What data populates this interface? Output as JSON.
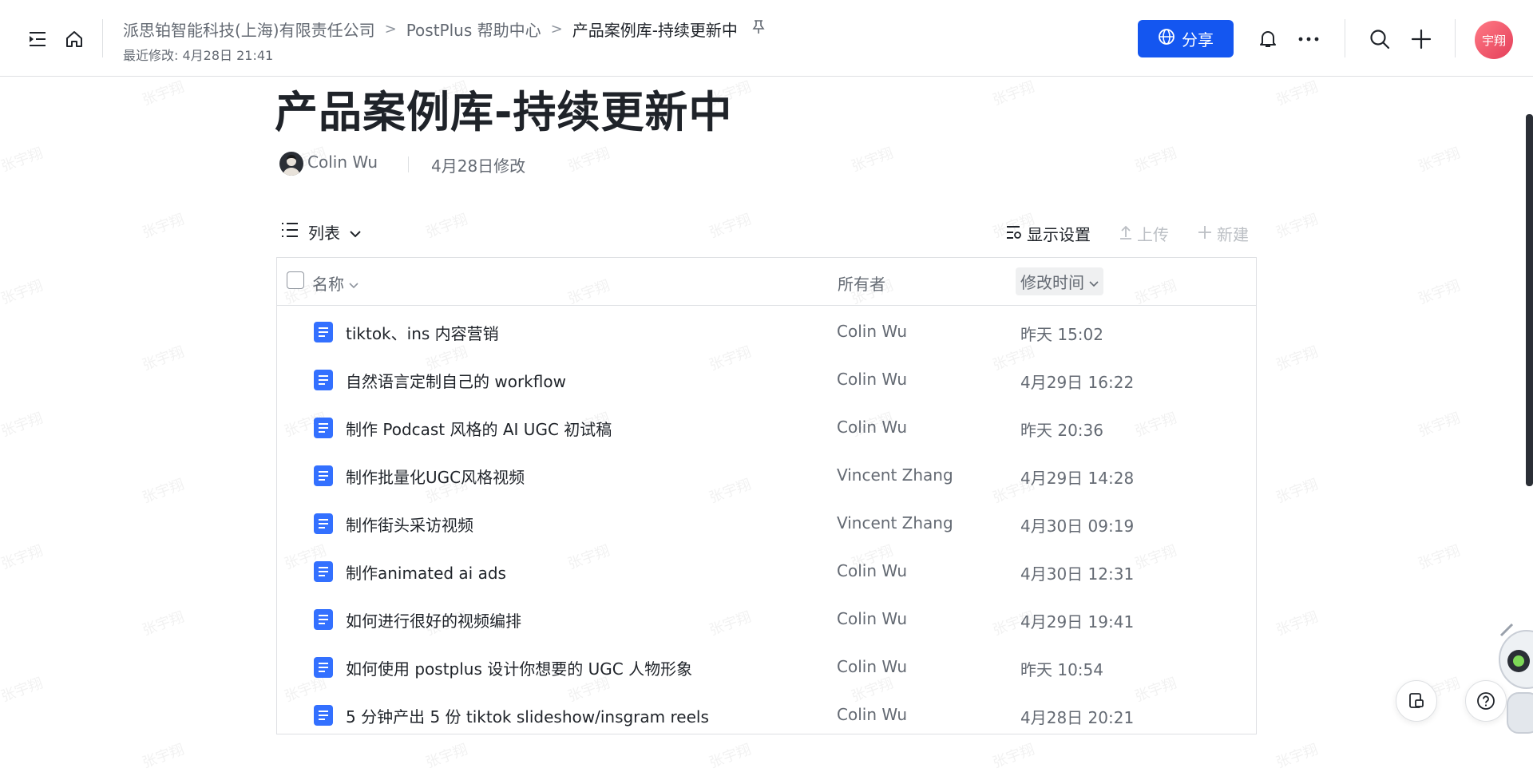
{
  "header": {
    "breadcrumbs": [
      "派思铂智能科技(上海)有限责任公司",
      "PostPlus 帮助中心",
      "产品案例库-持续更新中"
    ],
    "last_modified": "最近修改: 4月28日 21:41",
    "share_label": "分享",
    "user_avatar_text": "宇翔"
  },
  "doc": {
    "title": "产品案例库-持续更新中",
    "author": "Colin Wu",
    "edited": "4月28日修改"
  },
  "toolbar": {
    "view_label": "列表",
    "display_settings": "显示设置",
    "upload": "上传",
    "new": "新建"
  },
  "table": {
    "columns": {
      "name": "名称",
      "owner": "所有者",
      "modified": "修改时间"
    },
    "rows": [
      {
        "name": "tiktok、ins 内容营销",
        "owner": "Colin Wu",
        "modified": "昨天 15:02"
      },
      {
        "name": "自然语言定制自己的 workflow",
        "owner": "Colin Wu",
        "modified": "4月29日 16:22"
      },
      {
        "name": "制作 Podcast 风格的 AI UGC 初试稿",
        "owner": "Colin Wu",
        "modified": "昨天 20:36"
      },
      {
        "name": "制作批量化UGC风格视频",
        "owner": "Vincent Zhang",
        "modified": "4月29日 14:28"
      },
      {
        "name": "制作街头采访视频",
        "owner": "Vincent Zhang",
        "modified": "4月30日 09:19"
      },
      {
        "name": "制作animated ai ads",
        "owner": "Colin Wu",
        "modified": "4月30日 12:31"
      },
      {
        "name": "如何进行很好的视频编排",
        "owner": "Colin Wu",
        "modified": "4月29日 19:41"
      },
      {
        "name": "如何使用 postplus 设计你想要的 UGC 人物形象",
        "owner": "Colin Wu",
        "modified": "昨天 10:54"
      },
      {
        "name": "5 分钟产出 5 份 tiktok slideshow/insgram reels",
        "owner": "Colin Wu",
        "modified": "4月28日 20:21"
      }
    ]
  },
  "watermark": "张宇翔",
  "colors": {
    "accent": "#1456f0",
    "doc_icon": "#3370ff",
    "avatar": "#e43f5a"
  }
}
